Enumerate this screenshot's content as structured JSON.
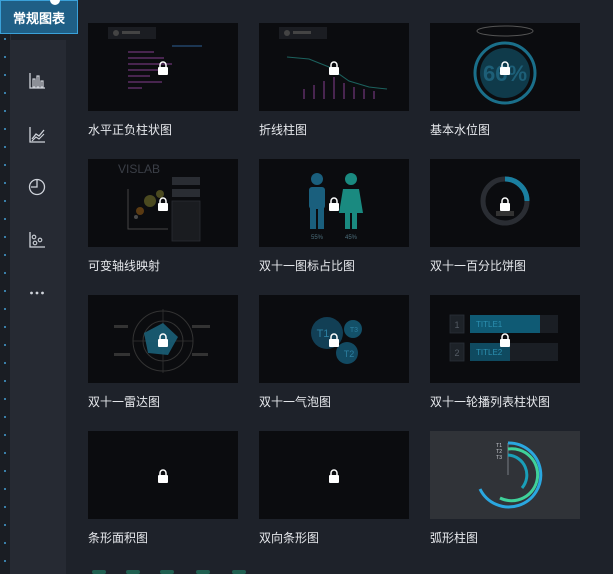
{
  "tab": {
    "label": "常规图表"
  },
  "sidebar": {
    "items": [
      {
        "icon": "bar-chart-icon"
      },
      {
        "icon": "line-chart-icon"
      },
      {
        "icon": "pie-chart-icon"
      },
      {
        "icon": "scatter-chart-icon"
      },
      {
        "icon": "more-icon"
      }
    ]
  },
  "charts": [
    {
      "label": "水平正负柱状图",
      "locked": true
    },
    {
      "label": "折线柱图",
      "locked": true
    },
    {
      "label": "基本水位图",
      "locked": true,
      "value_text": "66%"
    },
    {
      "label": "可变轴线映射",
      "locked": true,
      "title_text": "VISLAB"
    },
    {
      "label": "双十一图标占比图",
      "locked": true,
      "left_percent": "55%",
      "right_percent": "45%"
    },
    {
      "label": "双十一百分比饼图",
      "locked": true
    },
    {
      "label": "双十一雷达图",
      "locked": true
    },
    {
      "label": "双十一气泡图",
      "locked": true,
      "bubbles": [
        "T1",
        "T2",
        "T3"
      ]
    },
    {
      "label": "双十一轮播列表柱状图",
      "locked": true,
      "rows": [
        {
          "rank": "1",
          "title": "TITLE1"
        },
        {
          "rank": "2",
          "title": "TITLE2"
        }
      ]
    },
    {
      "label": "条形面积图",
      "locked": true
    },
    {
      "label": "双向条形图",
      "locked": true
    },
    {
      "label": "弧形柱图",
      "locked": false,
      "rings": [
        "T1",
        "T2",
        "T3"
      ]
    }
  ],
  "colors": {
    "accent": "#3aa1d9",
    "tab_bg": "#1f5f86",
    "thumb_bg": "#0b0c0f",
    "teal": "#1a9fb8",
    "green": "#3fd19a"
  }
}
